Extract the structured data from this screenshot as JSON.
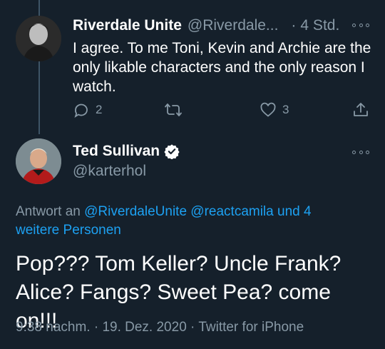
{
  "reply": {
    "author_name": "Riverdale Unite",
    "handle": "@Riverdale...",
    "separator": "·",
    "time": "4 Std.",
    "text": "I agree. To me Toni, Kevin and Archie are the only likable characters and the only reason I watch.",
    "reply_count": "2",
    "like_count": "3"
  },
  "tweet": {
    "author_name": "Ted Sullivan",
    "handle": "@karterhol",
    "reply_to_prefix": "Antwort an",
    "reply_to_users": "@RiverdaleUnite @reactcamila und 4 weitere Personen",
    "text": "Pop??? Tom Keller? Uncle Frank? Alice? Fangs? Sweet Pea? come on!!!",
    "timestamp": "9:38 nachm. · 19. Dez. 2020",
    "footer_separator": "·",
    "source": "Twitter for iPhone"
  },
  "colors": {
    "background": "#15202b",
    "muted": "#8899a6",
    "link": "#1da1f2",
    "thread_line": "#3d5466"
  },
  "icons": [
    "reply-icon",
    "retweet-icon",
    "like-icon",
    "share-icon",
    "verified-badge-icon",
    "more-options-icon"
  ]
}
